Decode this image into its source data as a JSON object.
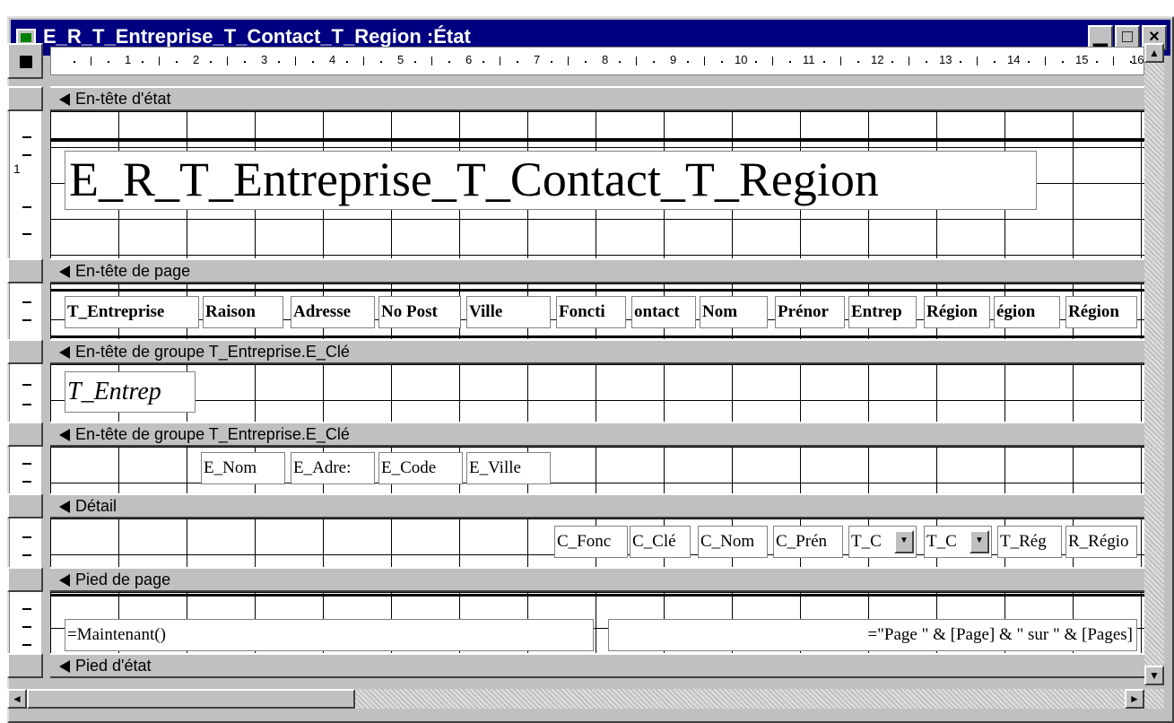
{
  "window": {
    "title": "E_R_T_Entreprise_T_Contact_T_Region :État",
    "minimize": "▁",
    "maximize": "□",
    "close": "×"
  },
  "ruler": {
    "marks": [
      "1",
      "2",
      "3",
      "4",
      "5",
      "6",
      "7",
      "8",
      "9",
      "10",
      "11",
      "12",
      "13",
      "14",
      "15",
      "16"
    ]
  },
  "vertical_ruler": {
    "mark": "1"
  },
  "sections": {
    "report_header": "En-tête d'état",
    "page_header": "En-tête de page",
    "group_header_1": "En-tête de groupe T_Entreprise.E_Clé",
    "group_header_2": "En-tête de groupe T_Entreprise.E_Clé",
    "detail": "Détail",
    "page_footer": "Pied de page",
    "report_footer": "Pied d'état"
  },
  "report_title": "E_R_T_Entreprise_T_Contact_T_Region",
  "page_header_labels": [
    "T_Entreprise",
    "Raison",
    "Adresse",
    "No Post",
    "Ville",
    "Foncti",
    "ontact",
    "Nom",
    "Prénor",
    "Entrep",
    "Région",
    "égion",
    "Région"
  ],
  "group1_field": "T_Entrep",
  "group2_fields": [
    "E_Nom",
    "E_Adre:",
    "E_Code",
    "E_Ville"
  ],
  "detail_fields": [
    "C_Fonc",
    "C_Clé",
    "C_Nom",
    "C_Prén",
    "T_C",
    "T_C",
    "T_Rég",
    "R_Régio"
  ],
  "page_footer": {
    "left": "=Maintenant()",
    "right": "=\"Page \" & [Page] & \" sur \" & [Pages]"
  },
  "scroll": {
    "up": "▲",
    "down": "▼",
    "left": "◄",
    "right": "►"
  }
}
